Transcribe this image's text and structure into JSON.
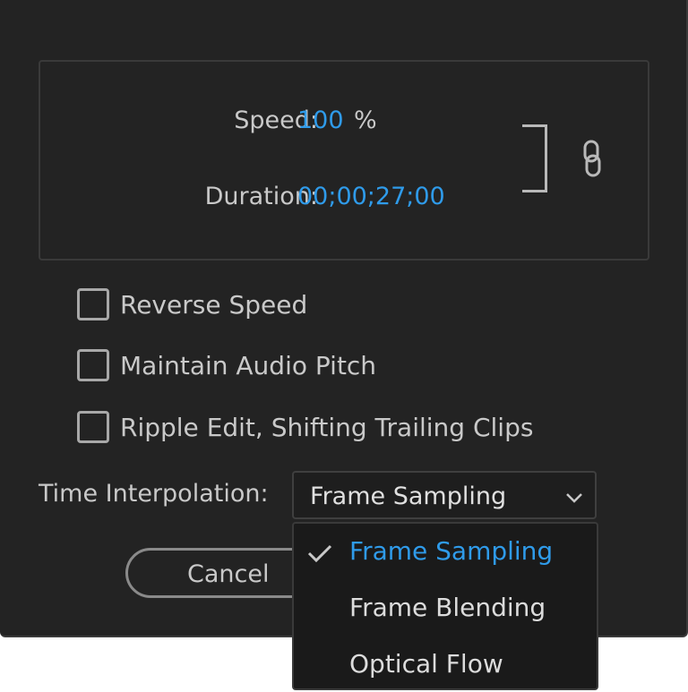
{
  "speed_duration": {
    "speed_label": "Speed:",
    "speed_value": "100",
    "speed_unit": "%",
    "duration_label": "Duration:",
    "duration_value": "00;00;27;00",
    "link_icon": "chain-link-icon"
  },
  "options": [
    {
      "label": "Reverse Speed",
      "checked": false
    },
    {
      "label": "Maintain Audio Pitch",
      "checked": false
    },
    {
      "label": "Ripple Edit, Shifting Trailing Clips",
      "checked": false
    }
  ],
  "time_interpolation": {
    "label": "Time Interpolation:",
    "selected": "Frame Sampling",
    "menu": [
      {
        "label": "Frame Sampling",
        "selected": true
      },
      {
        "label": "Frame Blending",
        "selected": false
      },
      {
        "label": "Optical Flow",
        "selected": false
      }
    ]
  },
  "buttons": {
    "cancel": "Cancel"
  },
  "colors": {
    "background": "#232323",
    "accent": "#2f9bea",
    "text": "#c9c9c9"
  }
}
